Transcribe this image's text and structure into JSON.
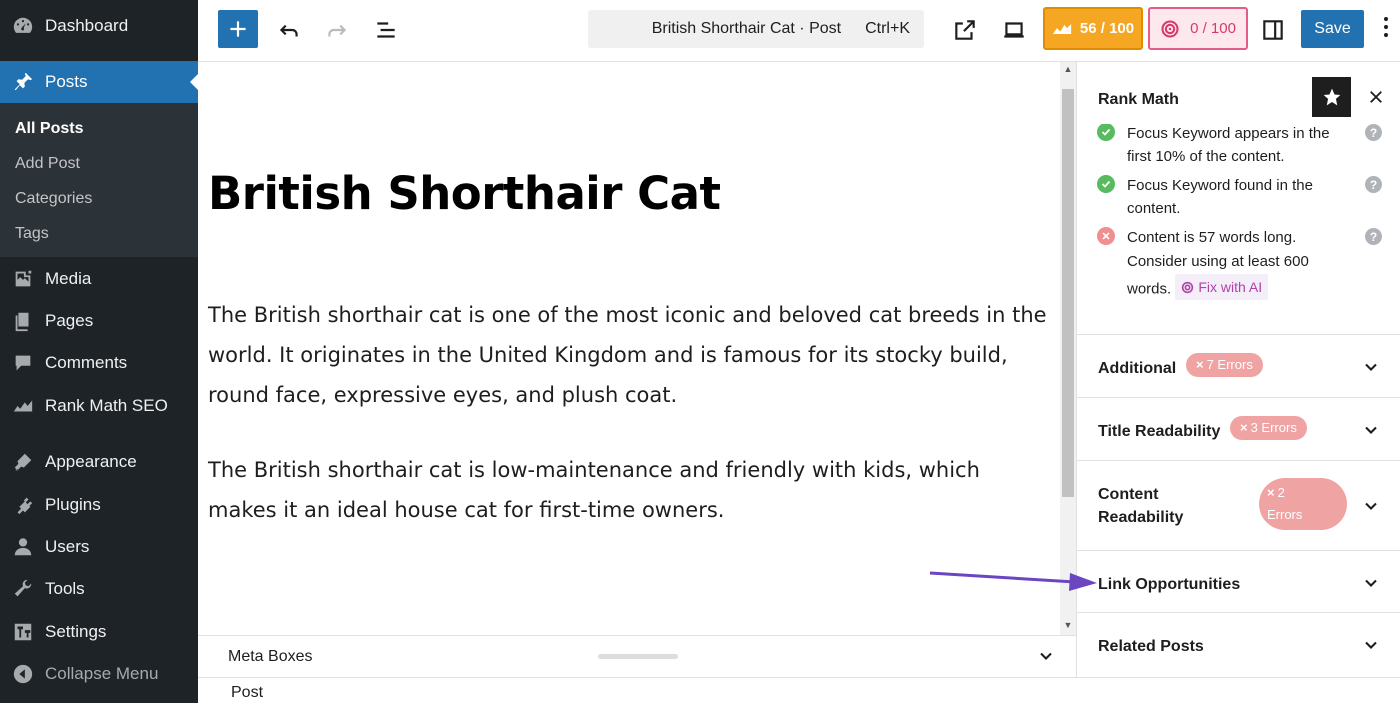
{
  "sidebar": {
    "items": [
      {
        "label": "Dashboard",
        "icon": "dashboard-icon"
      },
      {
        "label": "Posts",
        "icon": "pin-icon"
      },
      {
        "label": "Media",
        "icon": "media-icon"
      },
      {
        "label": "Pages",
        "icon": "pages-icon"
      },
      {
        "label": "Comments",
        "icon": "comments-icon"
      },
      {
        "label": "Rank Math SEO",
        "icon": "rankmath-icon"
      },
      {
        "label": "Appearance",
        "icon": "appearance-icon"
      },
      {
        "label": "Plugins",
        "icon": "plugins-icon"
      },
      {
        "label": "Users",
        "icon": "users-icon"
      },
      {
        "label": "Tools",
        "icon": "tools-icon"
      },
      {
        "label": "Settings",
        "icon": "settings-icon"
      },
      {
        "label": "Collapse Menu",
        "icon": "collapse-icon"
      }
    ],
    "submenu": [
      "All Posts",
      "Add Post",
      "Categories",
      "Tags"
    ]
  },
  "toolbar": {
    "command_title": "British Shorthair Cat · Post",
    "command_shortcut": "Ctrl+K",
    "seo_score": "56 / 100",
    "ai_score": "0 / 100",
    "save_label": "Save"
  },
  "post": {
    "title": "British Shorthair Cat",
    "paragraphs": [
      "The British shorthair cat is one of the most iconic and beloved cat breeds in the world. It originates in the United Kingdom and is famous for its stocky build, round face, expressive eyes, and plush coat.",
      "The British shorthair cat is low-maintenance and friendly with kids, which makes it an ideal house cat for first-time owners."
    ]
  },
  "metabox": {
    "label": "Meta Boxes",
    "footer_crumb": "Post"
  },
  "panel": {
    "title": "Rank Math",
    "checks": [
      {
        "text": "Focus Keyword appears in the first 10% of the content.",
        "status": "ok"
      },
      {
        "text": "Focus Keyword found in the content.",
        "status": "ok"
      },
      {
        "text": "Content is 57 words long. Consider using at least 600 words.",
        "status": "bad"
      }
    ],
    "fix_ai_label": "Fix with AI",
    "help_glyph": "?",
    "sections": [
      {
        "title": "Additional",
        "badge": "7 Errors"
      },
      {
        "title": "Title Readability",
        "badge": "3 Errors"
      },
      {
        "title": "Content Readability",
        "badge_line1": "2",
        "badge_line2": "Errors"
      },
      {
        "title": "Link Opportunities"
      },
      {
        "title": "Related Posts"
      }
    ]
  },
  "colors": {
    "wp_blue": "#2271b1",
    "seo_orange": "#f5a623",
    "ai_pink": "#e35d86",
    "error_badge": "#f0a3a3",
    "check_ok": "#58bb5f",
    "annotation_arrow": "#6b46c1"
  }
}
